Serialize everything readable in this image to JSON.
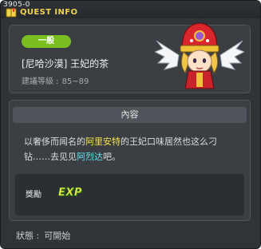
{
  "window": {
    "quest_id": "3905-0",
    "title": "QUEST INFO"
  },
  "header": {
    "category": "一般",
    "quest_name": "[尼哈沙漠] 王妃的茶",
    "level_label": "建議等級 :",
    "level_range": "85~89"
  },
  "content": {
    "heading": "內容",
    "text_1": "以奢侈而闻名的",
    "highlight_1": "阿里安特",
    "text_2": "的王妃口味居然也这么刁钻……去见见",
    "highlight_2": "阿烈达",
    "text_3": "吧。",
    "reward_label": "獎勵",
    "reward_icon": "EXP"
  },
  "status": {
    "label": "狀態 :",
    "value": "可開始"
  }
}
